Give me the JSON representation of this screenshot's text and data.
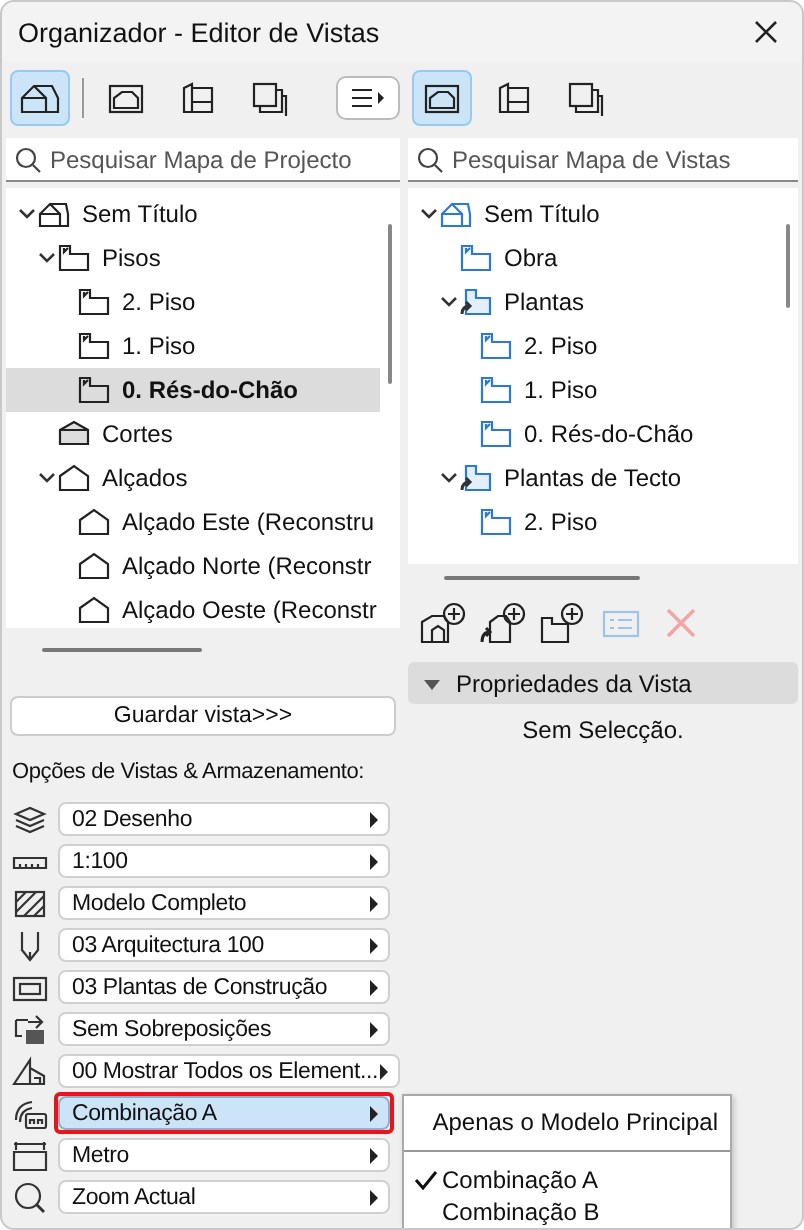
{
  "window": {
    "title": "Organizador - Editor de Vistas"
  },
  "left_panel": {
    "toolbar": [
      {
        "kind": "project",
        "selected": true
      },
      {
        "kind": "view",
        "selected": false
      },
      {
        "kind": "layout",
        "selected": false
      },
      {
        "kind": "publisher",
        "selected": false
      }
    ],
    "search": {
      "placeholder": "Pesquisar Mapa de Projecto"
    },
    "tree": [
      {
        "label": "Sem Título",
        "kind": "project",
        "selected": false,
        "expanded": true,
        "children": [
          {
            "label": "Pisos",
            "kind": "story",
            "selected": false,
            "expanded": true,
            "children": [
              {
                "label": "2. Piso",
                "kind": "story",
                "selected": false
              },
              {
                "label": "1. Piso",
                "kind": "story",
                "selected": false
              },
              {
                "label": "0. Rés-do-Chão",
                "kind": "story",
                "selected": true
              }
            ]
          },
          {
            "label": "Cortes",
            "kind": "section",
            "selected": false
          },
          {
            "label": "Alçados",
            "kind": "elevation",
            "selected": false,
            "expanded": true,
            "children": [
              {
                "label": "Alçado Este (Reconstru",
                "kind": "elevation",
                "selected": false
              },
              {
                "label": "Alçado Norte (Reconstr",
                "kind": "elevation",
                "selected": false
              },
              {
                "label": "Alçado Oeste (Reconstr",
                "kind": "elevation",
                "selected": false
              }
            ]
          }
        ]
      }
    ],
    "save_button": "Guardar vista>>>",
    "options_label": "Opções de Vistas & Armazenamento:",
    "options": [
      {
        "kind": "layers",
        "value": "02 Desenho",
        "selected": false
      },
      {
        "kind": "scale",
        "value": "1:100",
        "selected": false
      },
      {
        "kind": "structure",
        "value": "Modelo Completo",
        "selected": false
      },
      {
        "kind": "pen",
        "value": "03 Arquitectura 100",
        "selected": false
      },
      {
        "kind": "plan",
        "value": "03 Plantas de Construção",
        "selected": false
      },
      {
        "kind": "override",
        "value": "Sem Sobreposições",
        "selected": false
      },
      {
        "kind": "renovation",
        "value": "00 Mostrar Todos os Element...",
        "selected": false
      },
      {
        "kind": "combination",
        "value": "Combinação A",
        "selected": true
      },
      {
        "kind": "dimension",
        "value": "Metro",
        "selected": false
      },
      {
        "kind": "zoom",
        "value": "Zoom Actual",
        "selected": false
      }
    ]
  },
  "right_panel": {
    "toolbar": [
      {
        "kind": "view",
        "selected": true
      },
      {
        "kind": "layout",
        "selected": false
      },
      {
        "kind": "publisher",
        "selected": false
      }
    ],
    "search": {
      "placeholder": "Pesquisar Mapa de Vistas"
    },
    "tree": [
      {
        "label": "Sem Título",
        "kind": "project",
        "selected": false,
        "expanded": true,
        "children": [
          {
            "label": "Obra",
            "kind": "story",
            "selected": false
          },
          {
            "label": "Plantas",
            "kind": "clone",
            "selected": false,
            "expanded": true,
            "children": [
              {
                "label": "2. Piso",
                "kind": "story",
                "selected": false
              },
              {
                "label": "1. Piso",
                "kind": "story",
                "selected": false
              },
              {
                "label": "0. Rés-do-Chão",
                "kind": "story",
                "selected": false
              }
            ]
          },
          {
            "label": "Plantas de Tecto",
            "kind": "clone",
            "selected": false,
            "expanded": true,
            "children": [
              {
                "label": "2. Piso",
                "kind": "story",
                "selected": false
              }
            ]
          }
        ]
      }
    ],
    "actions": [
      {
        "kind": "new-view",
        "disabled": false
      },
      {
        "kind": "clone",
        "disabled": false
      },
      {
        "kind": "new-folder",
        "disabled": false
      },
      {
        "kind": "settings",
        "disabled": true
      },
      {
        "kind": "delete",
        "disabled": true
      }
    ],
    "properties": {
      "title": "Propriedades da Vista",
      "expanded": true,
      "message": "Sem Selecção."
    }
  },
  "popup_menu": {
    "sections": [
      {
        "items": [
          {
            "label": "Apenas o Modelo Principal",
            "checked": false
          }
        ]
      },
      {
        "items": [
          {
            "label": "Combinação A",
            "checked": true
          },
          {
            "label": "Combinação B",
            "checked": false
          }
        ]
      }
    ]
  }
}
